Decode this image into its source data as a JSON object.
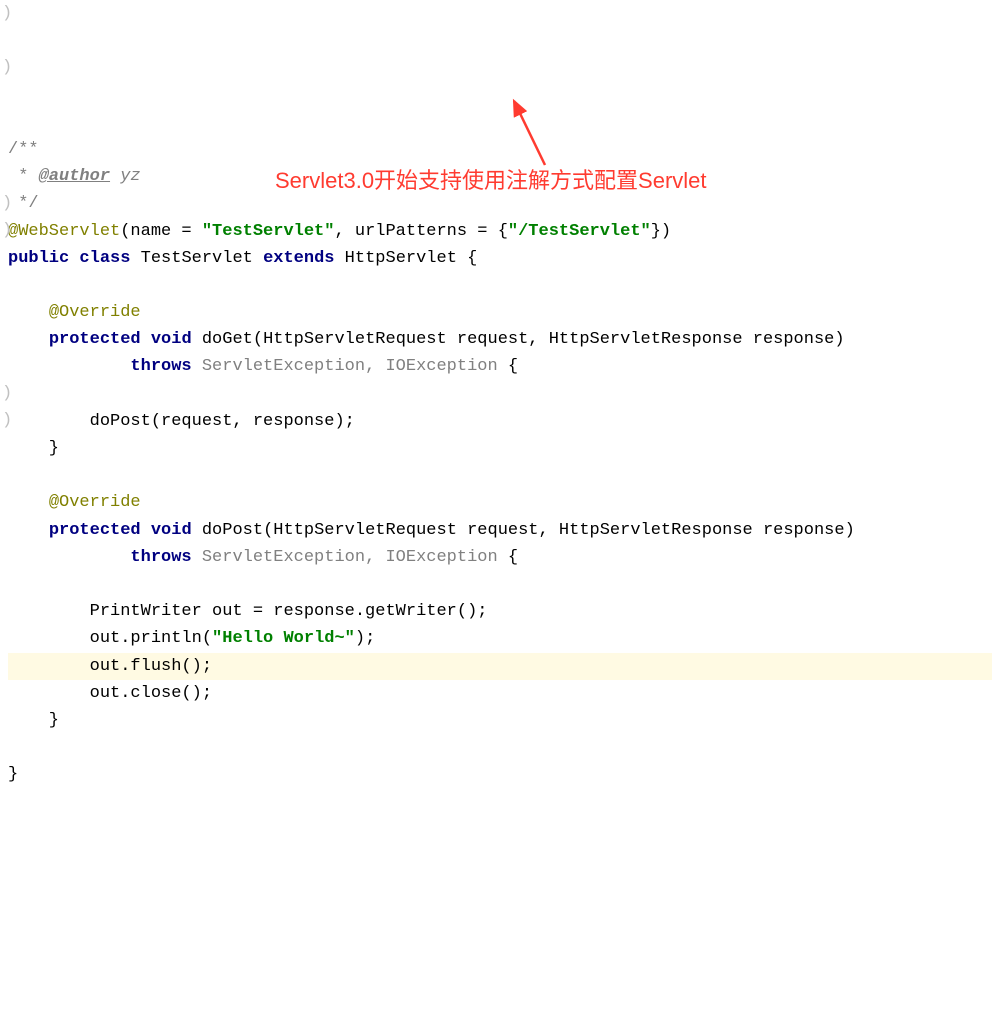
{
  "code": {
    "line1_comment_open": "/**",
    "line2_star": " * ",
    "line2_author_tag": "@author",
    "line2_author_name": " yz",
    "line3_comment_close": " */",
    "line4_annotation": "@WebServlet",
    "line4_text1": "(name = ",
    "line4_string1": "\"TestServlet\"",
    "line4_text2": ", urlPatterns = {",
    "line4_string2": "\"/TestServlet\"",
    "line4_text3": "})",
    "line5_kw1": "public",
    "line5_kw2": "class",
    "line5_name": " TestServlet ",
    "line5_kw3": "extends",
    "line5_parent": " HttpServlet {",
    "line7_override": "@Override",
    "line8_kw1": "protected",
    "line8_kw2": "void",
    "line8_method": " doGet(HttpServletRequest request, HttpServletResponse response)",
    "line9_kw": "throws",
    "line9_ex": " ServletException, IOException",
    "line9_brace": " {",
    "line11_body": "        doPost(request, response);",
    "line12_close": "    }",
    "line14_override": "@Override",
    "line15_kw1": "protected",
    "line15_kw2": "void",
    "line15_method": " doPost(HttpServletRequest request, HttpServletResponse response)",
    "line16_kw": "throws",
    "line16_ex": " ServletException, IOException",
    "line16_brace": " {",
    "line18_body": "        PrintWriter out = response.getWriter();",
    "line19_text1": "        out.println(",
    "line19_string": "\"Hello World~\"",
    "line19_text2": ");",
    "line20_body": "        out.flush();",
    "line21_body": "        out.close();",
    "line22_close": "    }",
    "line24_close": "}"
  },
  "annotation": {
    "text": "Servlet3.0开始支持使用注解方式配置Servlet",
    "color": "#ff3b30"
  }
}
